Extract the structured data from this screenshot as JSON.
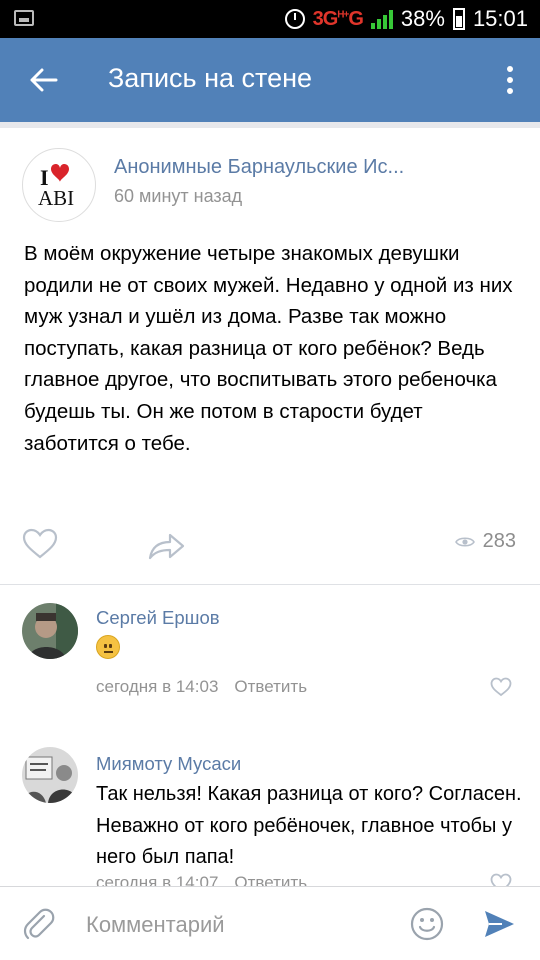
{
  "status_bar": {
    "network": "3G",
    "network_sub": "H+",
    "network_2": "G",
    "battery": "38%",
    "time": "15:01"
  },
  "app_bar": {
    "title": "Запись на стене",
    "back_icon": "arrow-back-icon",
    "more_icon": "more-vert-icon"
  },
  "post": {
    "author": "Анонимные Барнаульские Ис...",
    "time": "60 минут назад",
    "avatar_text_top": "I",
    "avatar_text_bottom": "ABI",
    "text": "В моём окружение четыре знакомых девушки родили не от своих мужей. Недавно у одной из них муж узнал и ушёл из дома. Разве так можно поступать, какая разница от кого ребёнок? Ведь главное другое, что воспитывать этого ребеночка будешь ты. Он же потом в старости будет заботится о тебе.",
    "views": "283"
  },
  "comments": [
    {
      "author": "Сергей Ершов",
      "text": "",
      "emoji": "neutral-face-emoji",
      "time": "сегодня в 14:03",
      "reply": "Ответить"
    },
    {
      "author": "Миямоту Мусаси",
      "text": "Так нельзя! Какая разница от кого? Согласен. Неважно от кого ребёночек, главное чтобы у него был папа!",
      "time": "сегодня в 14:07",
      "reply": "Ответить"
    }
  ],
  "input": {
    "placeholder": "Комментарий"
  },
  "colors": {
    "header": "#5181b8",
    "link": "#5b7ba6",
    "muted": "#939393",
    "accent_red": "#e0352b"
  }
}
